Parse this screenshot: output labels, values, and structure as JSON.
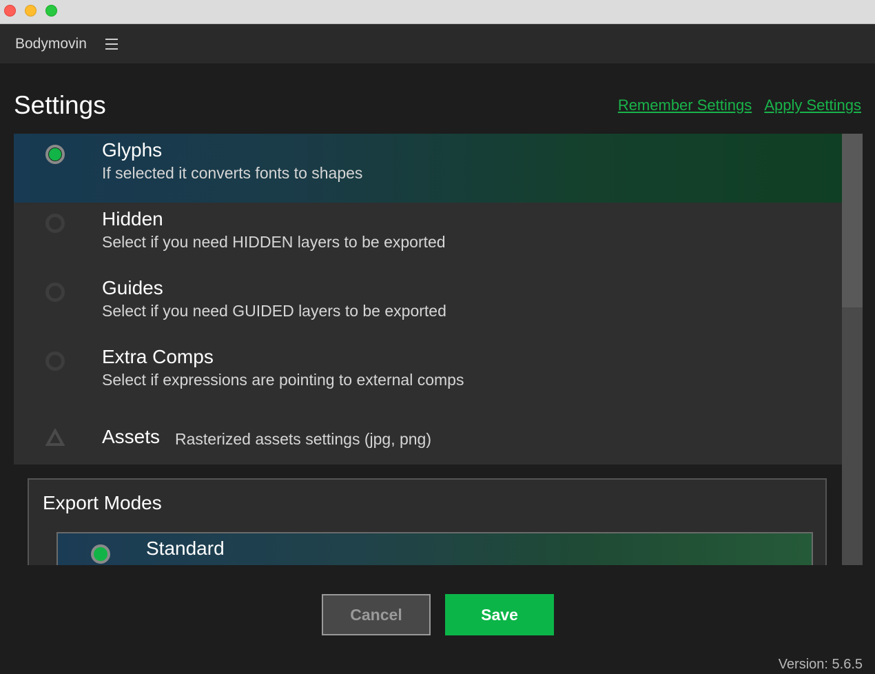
{
  "app": {
    "title": "Bodymovin"
  },
  "page": {
    "title": "Settings",
    "links": {
      "remember": "Remember Settings",
      "apply": "Apply Settings"
    }
  },
  "settings": [
    {
      "title": "Glyphs",
      "description": "If selected it converts fonts to shapes",
      "selected": true
    },
    {
      "title": "Hidden",
      "description": "Select if you need HIDDEN layers to be exported",
      "selected": false
    },
    {
      "title": "Guides",
      "description": "Select if you need GUIDED layers to be exported",
      "selected": false
    },
    {
      "title": "Extra Comps",
      "description": "Select if expressions are pointing to external comps",
      "selected": false
    }
  ],
  "assets": {
    "title": "Assets",
    "description": "Rasterized assets settings (jpg, png)"
  },
  "export_modes": {
    "title": "Export Modes",
    "modes": [
      {
        "title": "Standard",
        "selected": true
      }
    ]
  },
  "buttons": {
    "cancel": "Cancel",
    "save": "Save"
  },
  "footer": {
    "version": "Version: 5.6.5"
  },
  "colors": {
    "accent": "#0cb548",
    "background": "#1d1d1d",
    "panel": "#2f2f2f"
  }
}
